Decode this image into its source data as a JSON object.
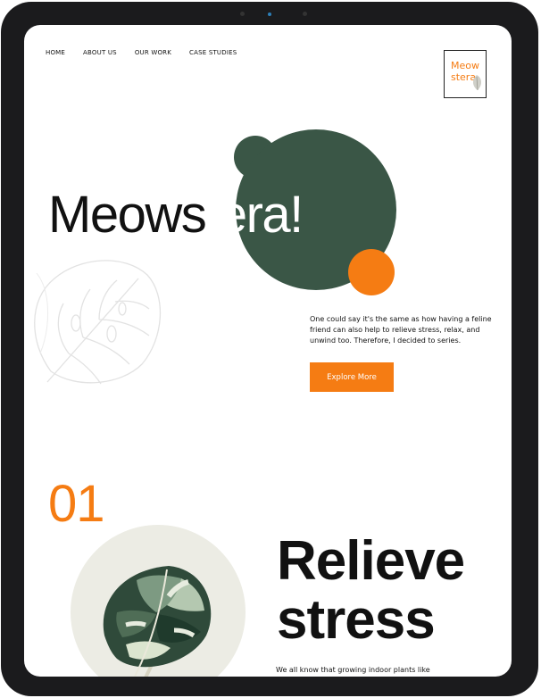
{
  "nav": {
    "items": [
      {
        "label": "HOME"
      },
      {
        "label": "ABOUT US"
      },
      {
        "label": "OUR WORK"
      },
      {
        "label": "CASE STUDIES"
      }
    ]
  },
  "logo": {
    "text": "Meowstera."
  },
  "hero": {
    "title_part1": "Meows",
    "title_part2": "tera!",
    "description": "One could say it's the same as how having a feline friend can also help to relieve stress, relax, and unwind too. Therefore, I decided to series.",
    "cta_label": "Explore More"
  },
  "section1": {
    "number": "01",
    "heading_line1": "Relieve",
    "heading_line2": "stress",
    "teaser": "We all know that growing indoor plants like"
  },
  "colors": {
    "accent": "#f57c13",
    "dark_green": "#3a5646",
    "circle_bg": "#ecece4"
  },
  "icons": [
    "monstera-leaf-outline-icon",
    "monstera-leaf-illustration-icon",
    "logo-leaf-icon"
  ]
}
